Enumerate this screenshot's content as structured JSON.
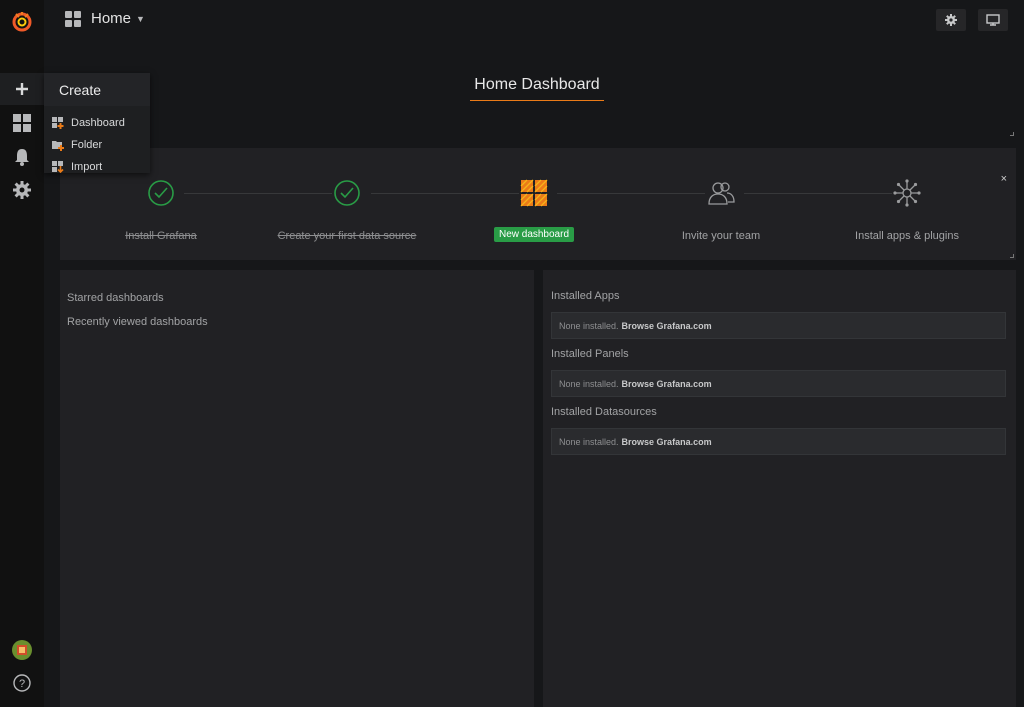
{
  "topbar": {
    "title": "Home"
  },
  "create_menu": {
    "header": "Create",
    "items": [
      {
        "label": "Dashboard",
        "icon": "dashboard-plus-icon"
      },
      {
        "label": "Folder",
        "icon": "folder-plus-icon"
      },
      {
        "label": "Import",
        "icon": "import-icon"
      }
    ]
  },
  "dashboard": {
    "title": "Home Dashboard"
  },
  "getting_started": {
    "steps": [
      {
        "label": "Install Grafana",
        "done": true
      },
      {
        "label": "Create your first data source",
        "done": true
      },
      {
        "label": "New dashboard",
        "active": true
      },
      {
        "label": "Invite your team"
      },
      {
        "label": "Install apps & plugins"
      }
    ],
    "close": "×"
  },
  "dashlists": {
    "starred": "Starred dashboards",
    "recent": "Recently viewed dashboards"
  },
  "plugins": [
    {
      "title": "Installed Apps",
      "none_text": "None installed.",
      "link": "Browse Grafana.com"
    },
    {
      "title": "Installed Panels",
      "none_text": "None installed.",
      "link": "Browse Grafana.com"
    },
    {
      "title": "Installed Datasources",
      "none_text": "None installed.",
      "link": "Browse Grafana.com"
    }
  ],
  "colors": {
    "accent": "#eb7b18",
    "success": "#299c46"
  }
}
